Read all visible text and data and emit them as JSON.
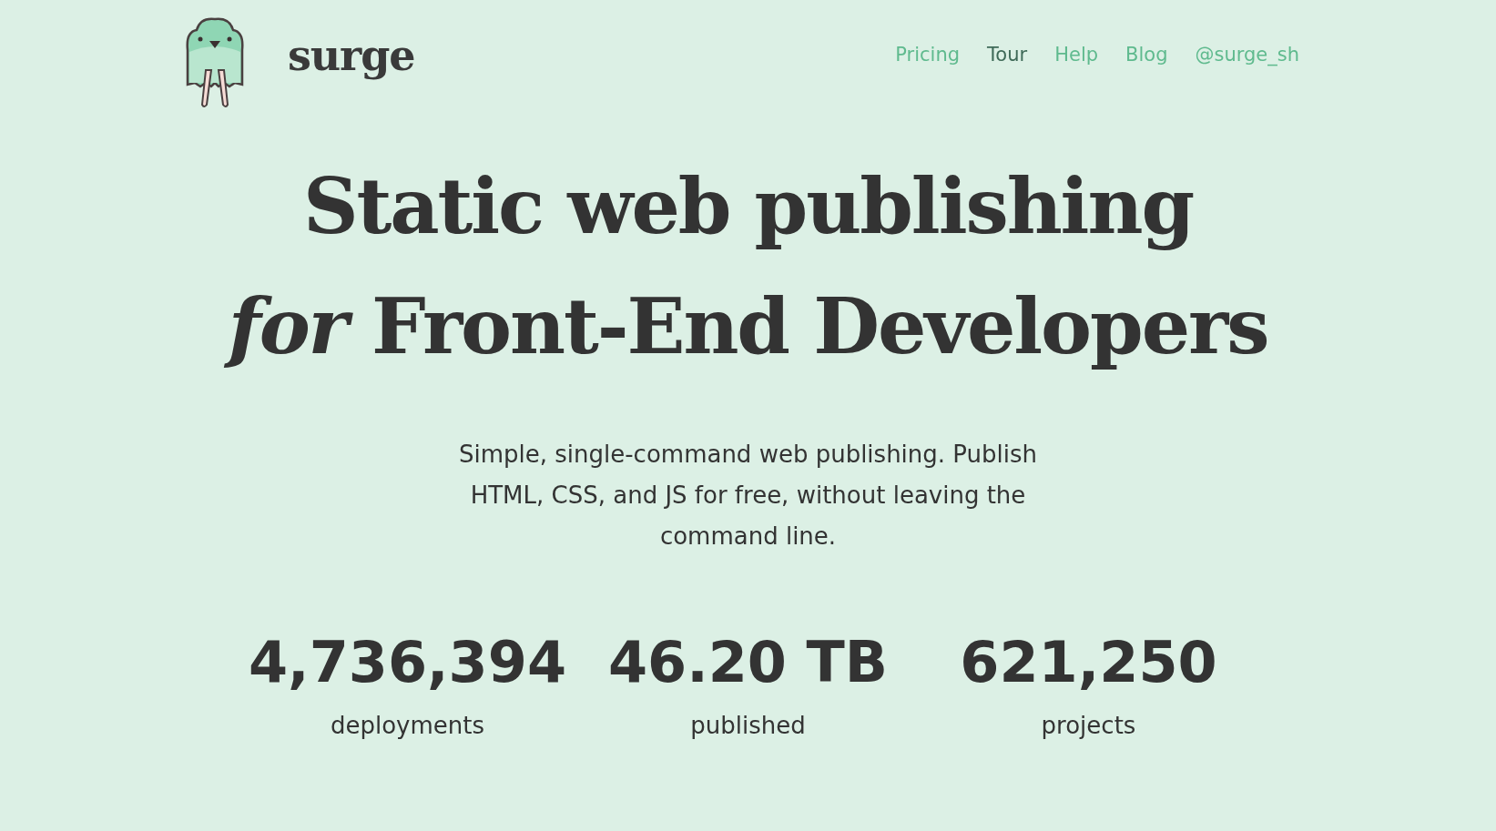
{
  "brand": {
    "name": "surge"
  },
  "nav": [
    {
      "label": "Pricing",
      "selected": false
    },
    {
      "label": "Tour",
      "selected": true
    },
    {
      "label": "Help",
      "selected": false
    },
    {
      "label": "Blog",
      "selected": false
    },
    {
      "label": "@surge_sh",
      "selected": false
    }
  ],
  "hero": {
    "headline_line_1": "Static web publishing",
    "headline_line_2": "*for* Front-End Developers",
    "tagline": "Simple, single-command web publishing. Publish HTML, CSS, and JS for free, without leaving the command line."
  },
  "stats": [
    {
      "value": "4,736,394",
      "label": "deployments"
    },
    {
      "value": "46.20 TB",
      "label": "published"
    },
    {
      "value": "621,250",
      "label": "projects"
    }
  ]
}
